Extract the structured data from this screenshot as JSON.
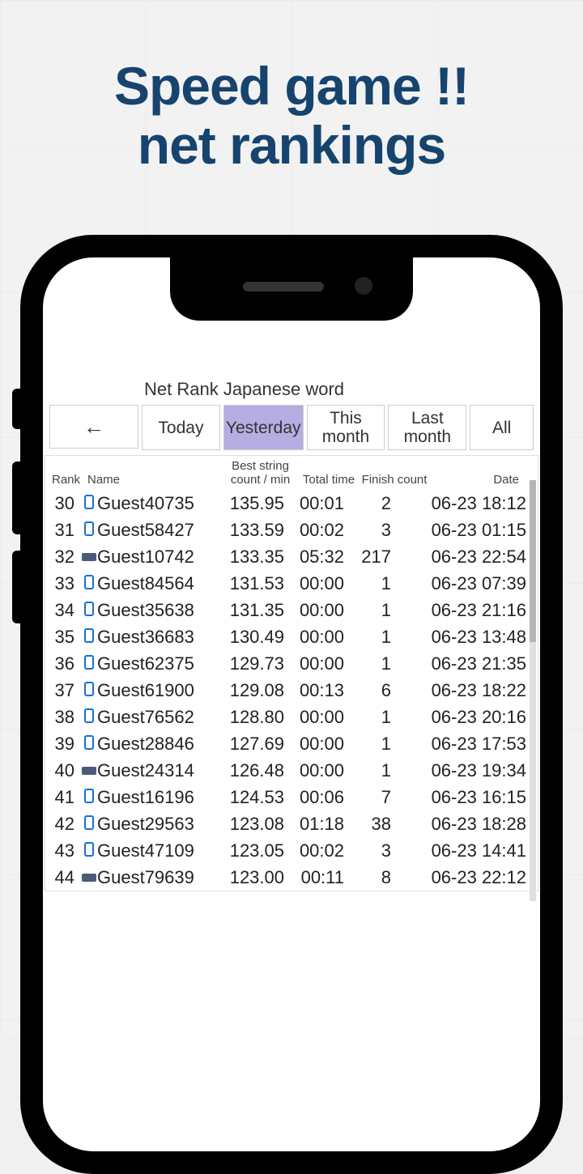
{
  "promo": {
    "line1": "Speed game !!",
    "line2": "net rankings"
  },
  "screen": {
    "title": "Net Rank Japanese word",
    "back_arrow": "←",
    "tabs": [
      {
        "id": "today",
        "label": "Today",
        "active": false
      },
      {
        "id": "yesterday",
        "label": "Yesterday",
        "active": true
      },
      {
        "id": "this-month",
        "label": "This month",
        "active": false
      },
      {
        "id": "last-month",
        "label": "Last month",
        "active": false
      },
      {
        "id": "all",
        "label": "All",
        "active": false
      }
    ]
  },
  "table": {
    "headers": {
      "rank": "Rank",
      "name": "Name",
      "score": "Best string count / min",
      "time": "Total time",
      "finish": "Finish count",
      "date": "Date"
    },
    "rows": [
      {
        "rank": 30,
        "device": "mobile",
        "name": "Guest40735",
        "score": "135.95",
        "time": "00:01",
        "finish": 2,
        "date": "06-23 18:12"
      },
      {
        "rank": 31,
        "device": "mobile",
        "name": "Guest58427",
        "score": "133.59",
        "time": "00:02",
        "finish": 3,
        "date": "06-23 01:15"
      },
      {
        "rank": 32,
        "device": "desktop",
        "name": "Guest10742",
        "score": "133.35",
        "time": "05:32",
        "finish": 217,
        "date": "06-23 22:54"
      },
      {
        "rank": 33,
        "device": "mobile",
        "name": "Guest84564",
        "score": "131.53",
        "time": "00:00",
        "finish": 1,
        "date": "06-23 07:39"
      },
      {
        "rank": 34,
        "device": "mobile",
        "name": "Guest35638",
        "score": "131.35",
        "time": "00:00",
        "finish": 1,
        "date": "06-23 21:16"
      },
      {
        "rank": 35,
        "device": "mobile",
        "name": "Guest36683",
        "score": "130.49",
        "time": "00:00",
        "finish": 1,
        "date": "06-23 13:48"
      },
      {
        "rank": 36,
        "device": "mobile",
        "name": "Guest62375",
        "score": "129.73",
        "time": "00:00",
        "finish": 1,
        "date": "06-23 21:35"
      },
      {
        "rank": 37,
        "device": "mobile",
        "name": "Guest61900",
        "score": "129.08",
        "time": "00:13",
        "finish": 6,
        "date": "06-23 18:22"
      },
      {
        "rank": 38,
        "device": "mobile",
        "name": "Guest76562",
        "score": "128.80",
        "time": "00:00",
        "finish": 1,
        "date": "06-23 20:16"
      },
      {
        "rank": 39,
        "device": "mobile",
        "name": "Guest28846",
        "score": "127.69",
        "time": "00:00",
        "finish": 1,
        "date": "06-23 17:53"
      },
      {
        "rank": 40,
        "device": "desktop",
        "name": "Guest24314",
        "score": "126.48",
        "time": "00:00",
        "finish": 1,
        "date": "06-23 19:34"
      },
      {
        "rank": 41,
        "device": "mobile",
        "name": "Guest16196",
        "score": "124.53",
        "time": "00:06",
        "finish": 7,
        "date": "06-23 16:15"
      },
      {
        "rank": 42,
        "device": "mobile",
        "name": "Guest29563",
        "score": "123.08",
        "time": "01:18",
        "finish": 38,
        "date": "06-23 18:28"
      },
      {
        "rank": 43,
        "device": "mobile",
        "name": "Guest47109",
        "score": "123.05",
        "time": "00:02",
        "finish": 3,
        "date": "06-23 14:41"
      },
      {
        "rank": 44,
        "device": "desktop",
        "name": "Guest79639",
        "score": "123.00",
        "time": "00:11",
        "finish": 8,
        "date": "06-23 22:12"
      }
    ]
  }
}
